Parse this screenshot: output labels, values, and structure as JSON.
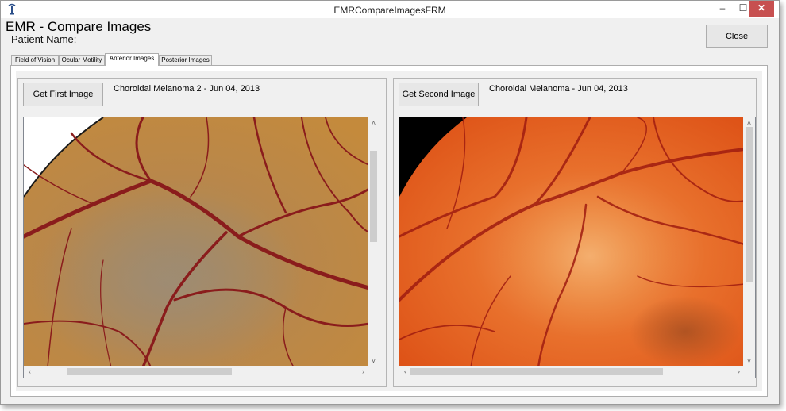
{
  "window": {
    "title": "EMRCompareImagesFRM",
    "controls": {
      "minimize": "–",
      "maximize": "☐",
      "close": "✕"
    }
  },
  "header": {
    "title": "EMR - Compare Images",
    "patient_label": "Patient Name:"
  },
  "close_button": "Close",
  "tabs": [
    {
      "label": "Field of Vision",
      "active": false
    },
    {
      "label": "Ocular Motility",
      "active": false
    },
    {
      "label": "Anterior Images",
      "active": true
    },
    {
      "label": "Posterior Images",
      "active": false
    }
  ],
  "left": {
    "button": "Get First Image",
    "caption": "Choroidal Melanoma 2 - Jun 04, 2013",
    "image_icon": "fundus-photo"
  },
  "right": {
    "button": "Get Second Image",
    "caption": "Choroidal Melanoma - Jun 04, 2013",
    "image_icon": "fundus-photo"
  },
  "scroll_glyphs": {
    "up": "˄",
    "down": "˅",
    "left": "‹",
    "right": "›"
  },
  "colors": {
    "close_red": "#c75050",
    "left_fundus": "#b8864a",
    "right_fundus": "#e05a1c",
    "vessel": "#8a1c1c"
  }
}
